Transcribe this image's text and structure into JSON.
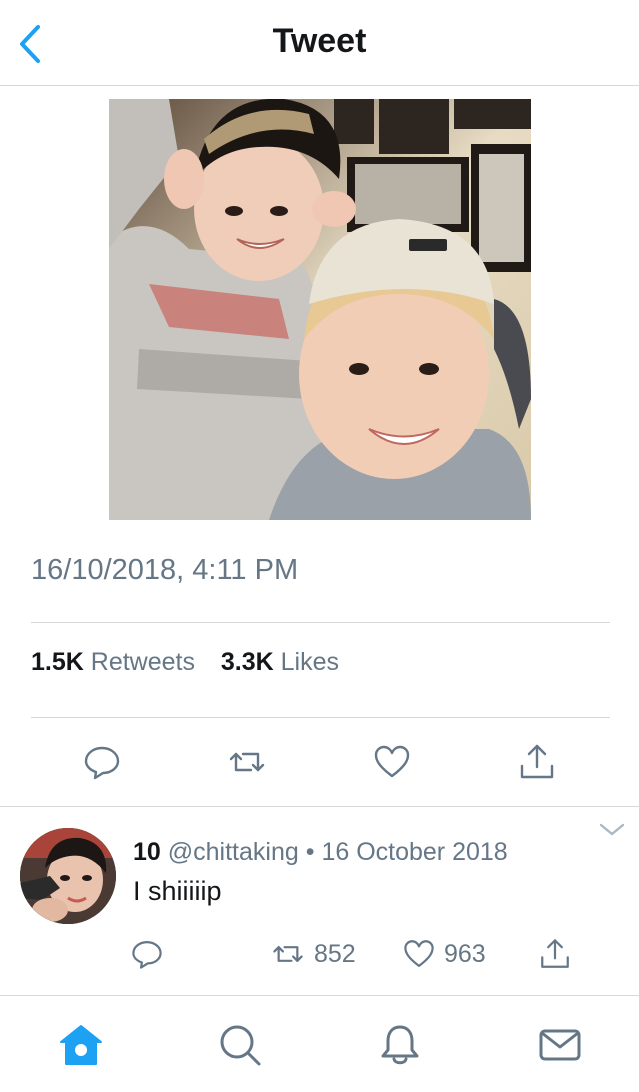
{
  "header": {
    "title": "Tweet",
    "back_icon": "chevron-left-icon",
    "accent": "#1da1f2"
  },
  "tweet": {
    "image": {
      "alt": "Selfie photo"
    },
    "timestamp": "16/10/2018, 4:11 PM",
    "retweets": {
      "count": "1.5K",
      "label": "Retweets"
    },
    "likes": {
      "count": "3.3K",
      "label": "Likes"
    },
    "actions": [
      "reply-icon",
      "retweet-icon",
      "like-icon",
      "share-icon"
    ]
  },
  "reply": {
    "name": "10",
    "handle": "@chittaking",
    "separator": "•",
    "date": "16 October 2018",
    "text": "I shiiiiip",
    "retweet_count": "852",
    "like_count": "963"
  },
  "tabbar": {
    "items": [
      "home-icon",
      "search-icon",
      "notifications-icon",
      "messages-icon"
    ],
    "active": "home-icon"
  },
  "colors": {
    "text": "#14171a",
    "secondary": "#657786",
    "divider": "#d6d9dc",
    "accent": "#1da1f2"
  }
}
